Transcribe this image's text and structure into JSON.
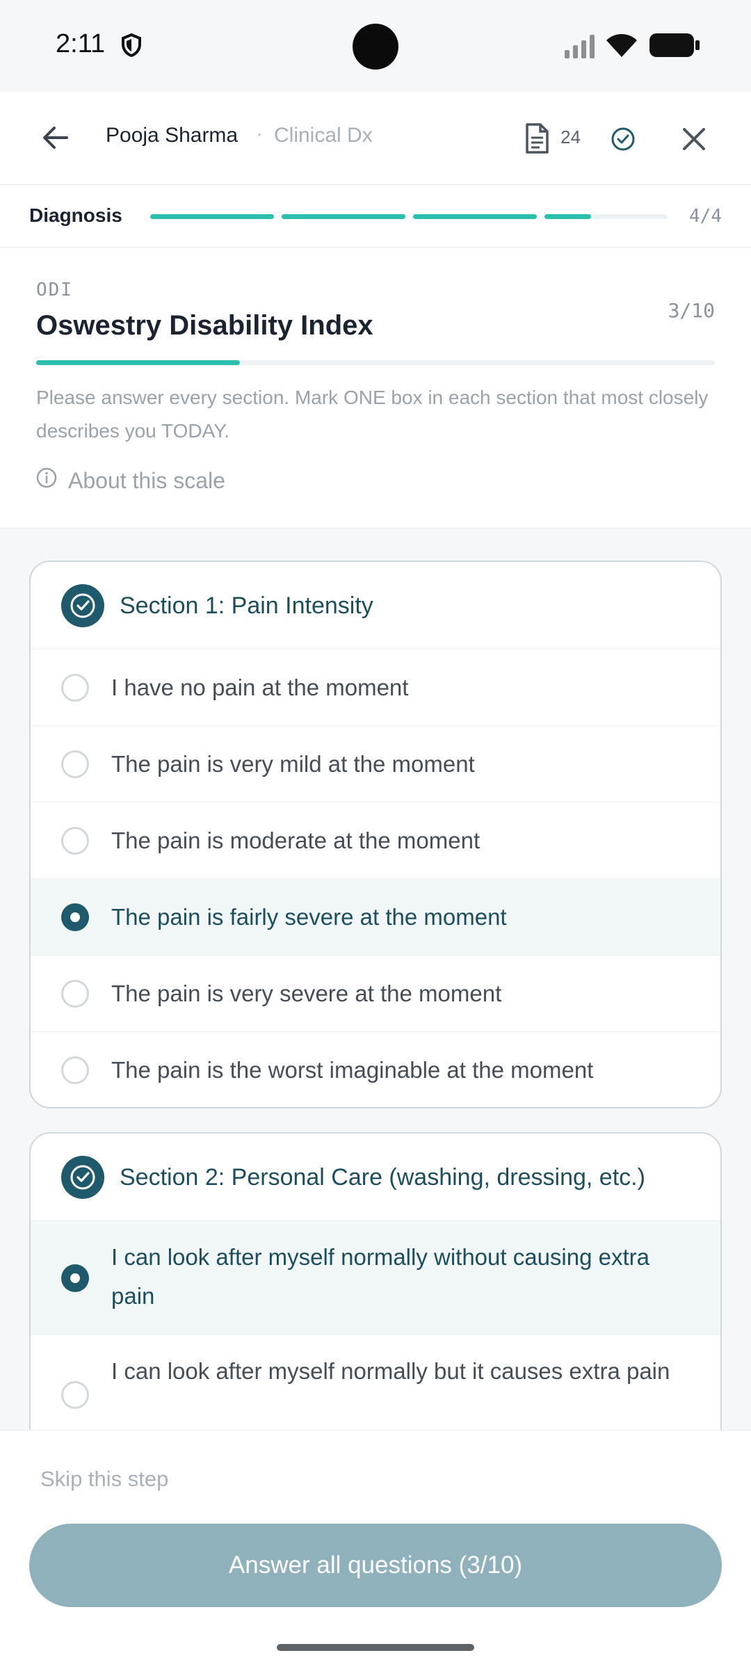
{
  "status_bar": {
    "time": "2:11"
  },
  "header": {
    "patient_name": "Pooja Sharma",
    "separator": "·",
    "context": "Clinical Dx",
    "doc_count": "24"
  },
  "step": {
    "label": "Diagnosis",
    "count": "4/4",
    "segments_progress": [
      1,
      1,
      1,
      0.38
    ]
  },
  "scale": {
    "code": "ODI",
    "title": "Oswestry Disability Index",
    "question_count": "3/10",
    "progress": 0.3,
    "instructions": "Please answer every section. Mark ONE box in each section that most closely describes you TODAY.",
    "about_label": "About this scale"
  },
  "sections": [
    {
      "title": "Section 1: Pain Intensity",
      "options": [
        {
          "text": "I have no pain at the moment",
          "selected": false
        },
        {
          "text": "The pain is very mild at the moment",
          "selected": false
        },
        {
          "text": "The pain is moderate at the moment",
          "selected": false
        },
        {
          "text": "The pain is fairly severe at the moment",
          "selected": true
        },
        {
          "text": "The pain is very severe at the moment",
          "selected": false
        },
        {
          "text": "The pain is the worst imaginable at the moment",
          "selected": false
        }
      ]
    },
    {
      "title": "Section 2: Personal Care (washing, dressing, etc.)",
      "options": [
        {
          "text": "I can look after myself normally without causing extra pain",
          "selected": true
        },
        {
          "text": "I can look after myself normally but it causes extra pain",
          "selected": false
        }
      ]
    }
  ],
  "footer": {
    "skip_label": "Skip this step",
    "primary_label": "Answer all questions (3/10)"
  },
  "colors": {
    "accent_teal": "#2bbfae",
    "primary_dark": "#1e5a6b",
    "button_disabled": "#8fb1bc"
  }
}
